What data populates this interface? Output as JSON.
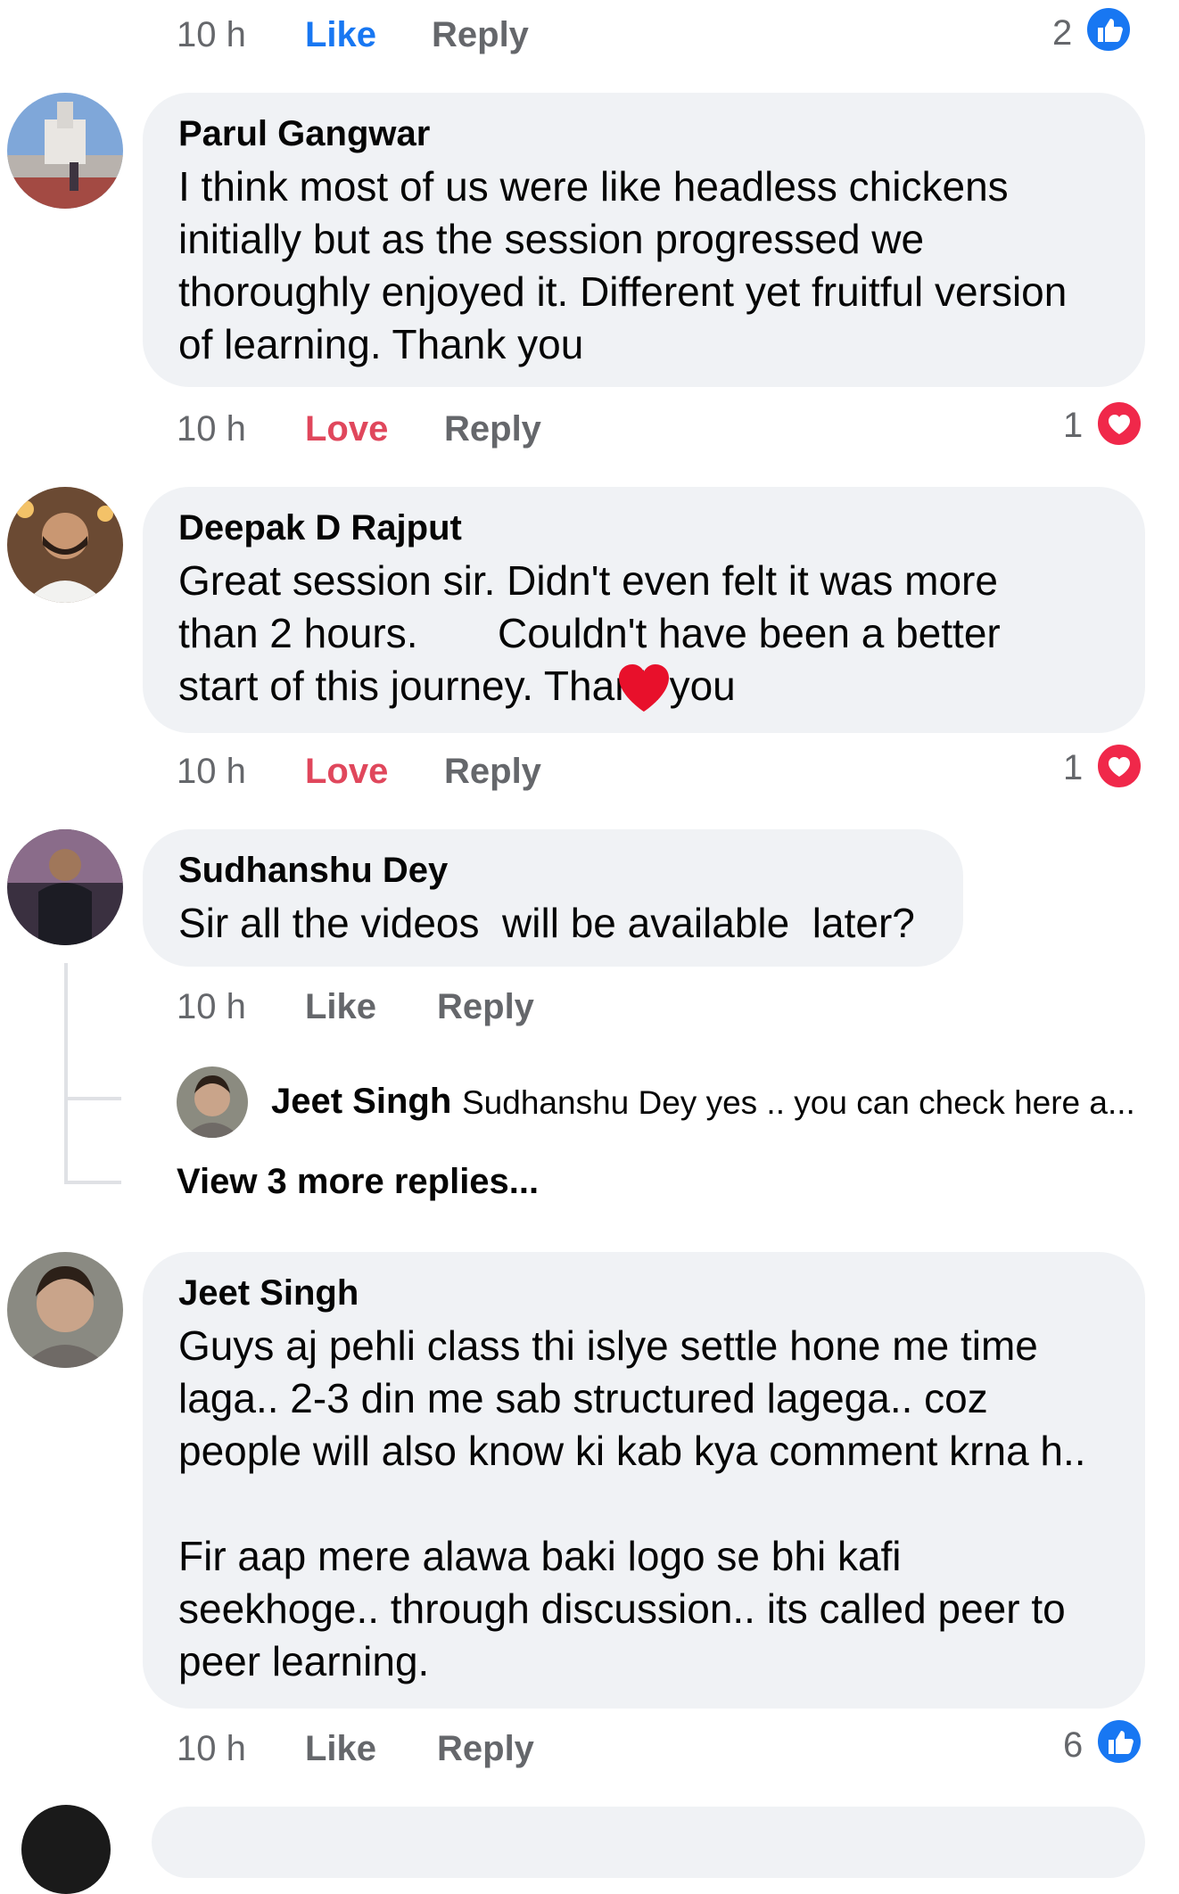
{
  "colors": {
    "bubble": "#f0f2f5",
    "muted": "#65676b",
    "like_blue": "#1877f2",
    "love_red": "#e0475c"
  },
  "top_actions": {
    "time": "10 h",
    "like": "Like",
    "reply": "Reply",
    "count": "2",
    "reaction_icon": "like-icon"
  },
  "comments": [
    {
      "author": "Parul Gangwar",
      "text": "I think most of us were like headless chickens initially but as the session progressed we thoroughly enjoyed it. Different yet fruitful version of learning. Thank you",
      "time": "10 h",
      "action": "Love",
      "reply": "Reply",
      "count": "1",
      "reaction_icon": "heart-icon"
    },
    {
      "author": "Deepak D Rajput",
      "text": "Great session sir. Didn't even felt it was more than 2 hours.       Couldn't have been a better start of this journey. Thank you",
      "text_emoji": "heart-emoji",
      "time": "10 h",
      "action": "Love",
      "reply": "Reply",
      "count": "1",
      "reaction_icon": "heart-icon"
    },
    {
      "author": "Sudhanshu Dey",
      "text": "Sir all the videos  will be available  later?",
      "time": "10 h",
      "action": "Like",
      "reply": "Reply",
      "reply_preview": {
        "author": "Jeet Singh",
        "text": "Sudhanshu Dey yes .. you can check here a..."
      },
      "view_more": "View 3 more replies..."
    },
    {
      "author": "Jeet Singh",
      "text": "Guys aj pehli class thi islye settle hone me time laga.. 2-3 din me sab structured lagega.. coz people will also know ki kab kya comment krna h..\n\nFir aap mere alawa baki logo se bhi kafi seekhoge.. through discussion.. its called peer to peer learning.",
      "time": "10 h",
      "action": "Like",
      "reply": "Reply",
      "count": "6",
      "reaction_icon": "like-icon"
    }
  ]
}
